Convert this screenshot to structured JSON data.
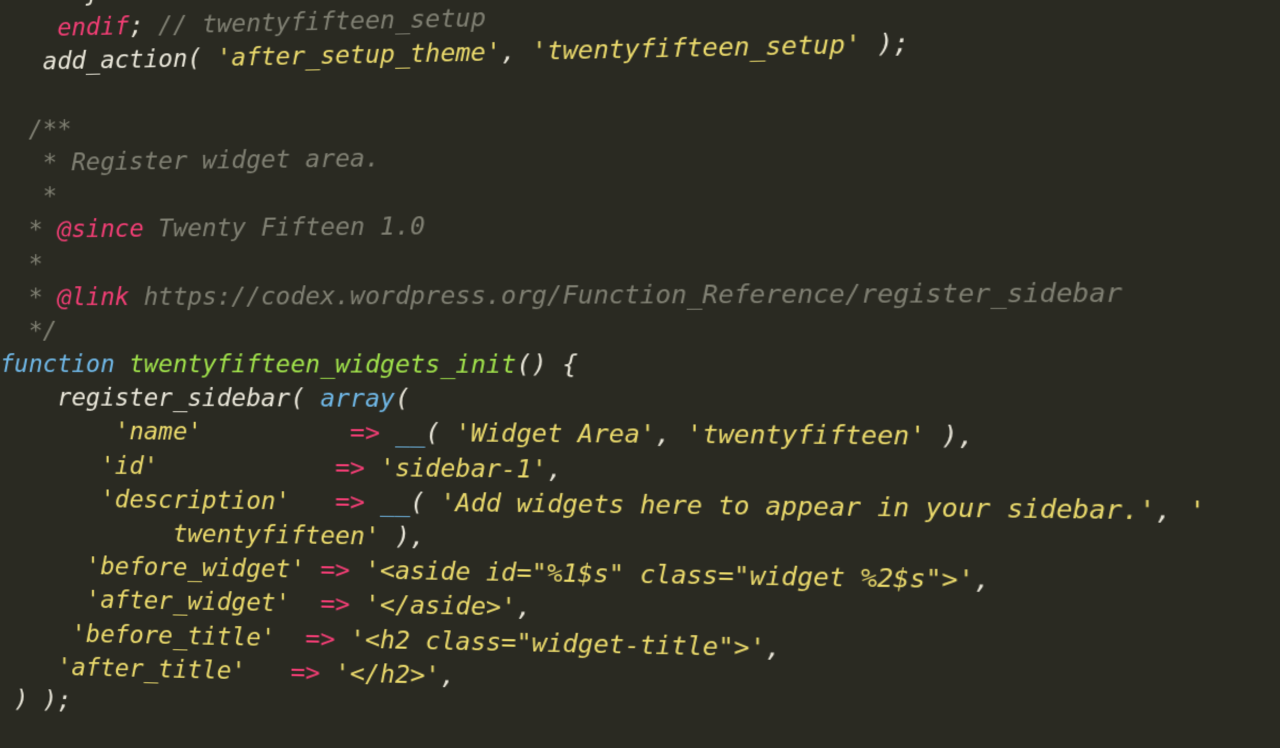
{
  "code": {
    "l1": "      }",
    "l2a": "    ",
    "l2_endif": "endif",
    "l2b": "; ",
    "l2_cmt": "// twentyfifteen_setup",
    "l3a": "   add_action( ",
    "l3_s1": "'after_setup_theme'",
    "l3b": ", ",
    "l3_s2": "'twentyfifteen_setup'",
    "l3c": " );",
    "l5": "  /**",
    "l6": "   * Register widget area.",
    "l7": "   *",
    "l8a": "  * ",
    "l8_tag": "@since",
    "l8b": " Twenty Fifteen 1.0",
    "l9": "  *",
    "l10a": "  * ",
    "l10_tag": "@link",
    "l10b": " https://codex.wordpress.org/Function_Reference/register_sidebar",
    "l11": "  */",
    "l12_fn": "function",
    "l12_sp": " ",
    "l12_name": "twentyfifteen_widgets_init",
    "l12_rest": "() {",
    "l13a": "    register_sidebar( ",
    "l13_arr": "array",
    "l13b": "(",
    "l14a": "        ",
    "l14_s1": "'name'",
    "l14_sp": "          ",
    "l14_op": "=>",
    "l14_b": " ",
    "l14_fn": "__",
    "l14_c": "( ",
    "l14_s2": "'Widget Area'",
    "l14_d": ", ",
    "l14_s3": "'twentyfifteen'",
    "l14_e": " ),",
    "l15a": "       ",
    "l15_s1": "'id'",
    "l15_sp": "            ",
    "l15_op": "=>",
    "l15_b": " ",
    "l15_s2": "'sidebar-1'",
    "l15_c": ",",
    "l16a": "       ",
    "l16_s1": "'description'",
    "l16_sp": "   ",
    "l16_op": "=>",
    "l16_b": " ",
    "l16_fn": "__",
    "l16_c": "( ",
    "l16_s2": "'Add widgets here to appear in your sidebar.'",
    "l16_d": ", ",
    "l16_s3a": "'",
    "l16w": "            twentyfifteen'",
    "l16_e": " ),",
    "l17a": "      ",
    "l17_s1": "'before_widget'",
    "l17_sp": " ",
    "l17_op": "=>",
    "l17_b": " ",
    "l17_s2": "'<aside id=\"%1$s\" class=\"widget %2$s\">'",
    "l17_c": ",",
    "l18a": "      ",
    "l18_s1": "'after_widget'",
    "l18_sp": "  ",
    "l18_op": "=>",
    "l18_b": " ",
    "l18_s2": "'</aside>'",
    "l18_c": ",",
    "l19a": "     ",
    "l19_s1": "'before_title'",
    "l19_sp": "  ",
    "l19_op": "=>",
    "l19_b": " ",
    "l19_s2": "'<h2 class=\"widget-title\">'",
    "l19_c": ",",
    "l20a": "    ",
    "l20_s1": "'after_title'",
    "l20_sp": "   ",
    "l20_op": "=>",
    "l20_b": " ",
    "l20_s2": "'</h2>'",
    "l20_c": ",",
    "l21": " ) );"
  }
}
